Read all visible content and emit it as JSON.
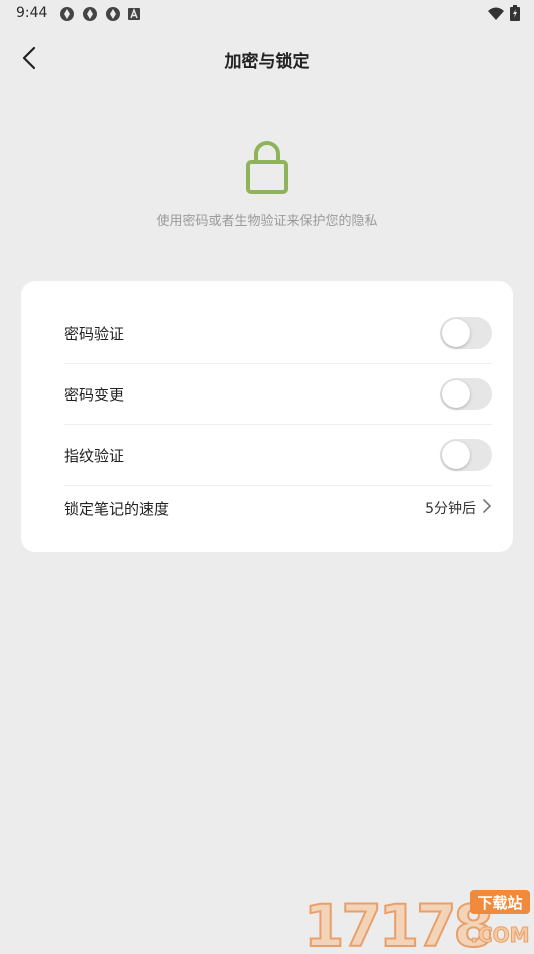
{
  "status": {
    "time": "9:44",
    "notification_icons": [
      "aperture-icon",
      "aperture-icon",
      "aperture-icon",
      "a-icon"
    ],
    "right_icons": [
      "wifi-icon",
      "battery-charging-icon"
    ]
  },
  "header": {
    "title": "加密与锁定",
    "back_icon": "chevron-left-icon"
  },
  "intro": {
    "icon": "lock-icon",
    "icon_color": "#8fb35a",
    "hint": "使用密码或者生物验证来保护您的隐私"
  },
  "settings": [
    {
      "label": "密码验证",
      "type": "toggle",
      "on": false
    },
    {
      "label": "密码变更",
      "type": "toggle",
      "on": false
    },
    {
      "label": "指纹验证",
      "type": "toggle",
      "on": false
    },
    {
      "label": "锁定笔记的速度",
      "type": "value",
      "value": "5分钟后"
    }
  ],
  "watermark": {
    "number": "17178",
    "text_top": "下载站",
    "text_bottom": ".COM"
  }
}
